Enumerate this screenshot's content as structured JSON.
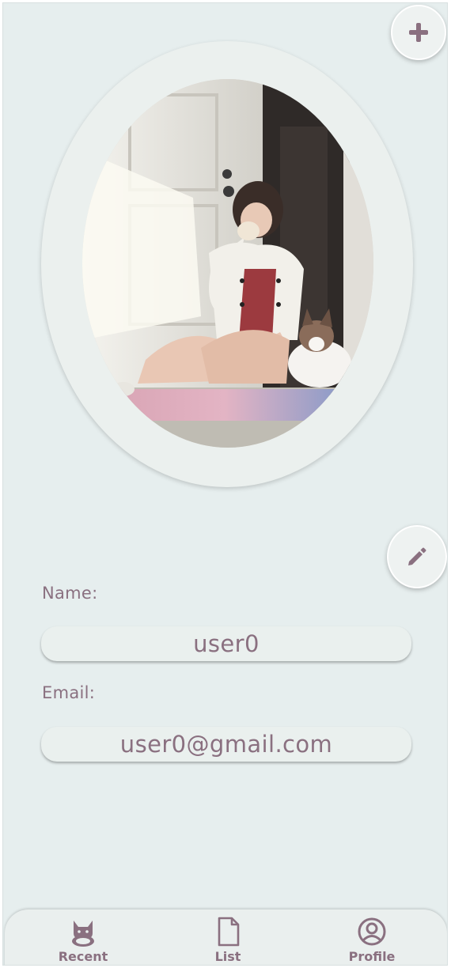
{
  "actions": {
    "add_icon": "plus-icon",
    "edit_icon": "pencil-icon"
  },
  "profile": {
    "photo_description_icon": "profile-photo",
    "name_label": "Name:",
    "name_value": "user0",
    "email_label": "Email:",
    "email_value": "user0@gmail.com"
  },
  "nav": {
    "items": [
      {
        "label": "Recent",
        "icon": "cat-icon"
      },
      {
        "label": "List",
        "icon": "document-icon"
      },
      {
        "label": "Profile",
        "icon": "user-circle-icon"
      }
    ]
  },
  "colors": {
    "background": "#e6eeee",
    "accent_text": "#8a7080",
    "card": "#eaf0ee"
  }
}
